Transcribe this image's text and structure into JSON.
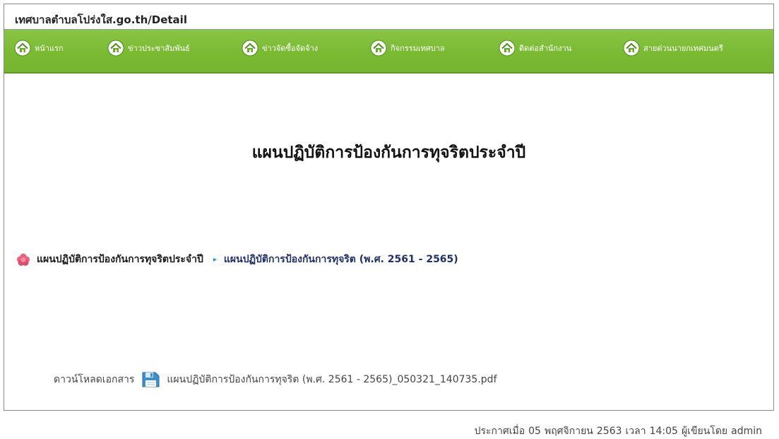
{
  "browser": {
    "url": "เทศบาลตำบลโปร่งใส.go.th/Detail"
  },
  "menu": {
    "items": [
      {
        "label": "หน้าแรก",
        "icon": "home-icon"
      },
      {
        "label": "ข่าวประชาสัมพันธ์",
        "icon": "home-icon"
      },
      {
        "label": "ข่าวจัดซื้อจัดจ้าง",
        "icon": "home-icon"
      },
      {
        "label": "กิจกรรมเทศบาล",
        "icon": "home-icon"
      },
      {
        "label": "ติดต่อสำนักงาน",
        "icon": "home-icon"
      },
      {
        "label": "สายด่วนนายกเทศมนตรี",
        "icon": "home-icon"
      }
    ],
    "bar_color": "#7bbb34"
  },
  "page": {
    "title": "แผนปฏิบัติการป้องกันการทุจริตประจำปี"
  },
  "breadcrumb": {
    "parent": "แผนปฏิบัติการป้องกันการทุจริตประจำปี",
    "separator": "▸",
    "current": "แผนปฏิบัติการป้องกันการทุจริต (พ.ศ. 2561 - 2565)",
    "icon": "flower-icon"
  },
  "download": {
    "label": "ดาวน์โหลดเอกสาร",
    "icon": "floppy-disk-icon",
    "filename": "แผนปฏิบัติการป้องกันการทุจริต (พ.ศ. 2561 - 2565)_050321_140735.pdf"
  },
  "posted": {
    "prefix": "ประกาศเมื่อ",
    "day": "05",
    "month": "พฤศจิกายน",
    "year": "2563",
    "time_label": "เวลา",
    "time": "14:05",
    "author_label": "ผู้เขียนโดย",
    "author": "admin"
  }
}
